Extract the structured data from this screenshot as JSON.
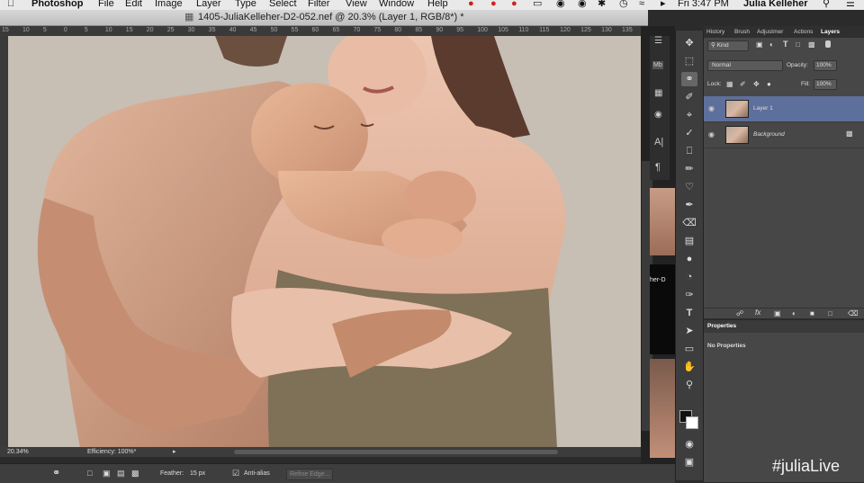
{
  "menubar": {
    "app": "Photoshop",
    "items": [
      "File",
      "Edit",
      "Image",
      "Layer",
      "Type",
      "Select",
      "Filter",
      "View",
      "Window",
      "Help"
    ],
    "clock": "Fri 3:47 PM",
    "user": "Julia Kelleher"
  },
  "document": {
    "title": "1405-JuliaKelleher-D2-052.nef @ 20.3% (Layer 1, RGB/8*) *"
  },
  "ruler": {
    "ticks": [
      "15",
      "10",
      "5",
      "0",
      "5",
      "10",
      "15",
      "20",
      "25",
      "30",
      "35",
      "40",
      "45",
      "50",
      "55",
      "60",
      "65",
      "70",
      "75",
      "80",
      "85",
      "90",
      "95",
      "100",
      "105",
      "110",
      "115",
      "120",
      "125",
      "130",
      "135"
    ]
  },
  "statusbar": {
    "zoom": "20.34%",
    "info": "Efficiency: 100%*"
  },
  "optionsbar": {
    "feather_label": "Feather:",
    "feather_value": "15 px",
    "antialias_label": "Anti-alias",
    "refine_label": "Refine Edge..."
  },
  "tools": [
    "move-tool",
    "marquee-tool",
    "lasso-tool",
    "quick-selection-tool",
    "crop-tool",
    "eyedropper-tool",
    "healing-brush-tool",
    "brush-tool",
    "clone-stamp-tool",
    "history-brush-tool",
    "eraser-tool",
    "gradient-tool",
    "blur-tool",
    "dodge-tool",
    "pen-tool",
    "type-tool",
    "path-selection-tool",
    "rectangle-tool",
    "hand-tool",
    "zoom-tool"
  ],
  "panel_tabs": [
    "History",
    "Brush",
    "Adjustmer",
    "Actions",
    "Layers"
  ],
  "layers": {
    "kind_label": "Kind",
    "blend_mode": "Normal",
    "opacity_label": "Opacity:",
    "opacity_value": "100%",
    "lock_label": "Lock:",
    "fill_label": "Fill:",
    "fill_value": "100%",
    "items": [
      {
        "name": "Layer 1",
        "selected": true
      },
      {
        "name": "Background",
        "selected": false,
        "locked": true
      }
    ]
  },
  "properties": {
    "tab": "Properties",
    "message": "No Properties"
  },
  "strip": {
    "label": "her-D"
  },
  "watermark": "#juliaLive",
  "colors": {
    "accent": "#5d6f9b",
    "panel": "#474747",
    "canvas_bg": "#c9c0b6"
  }
}
